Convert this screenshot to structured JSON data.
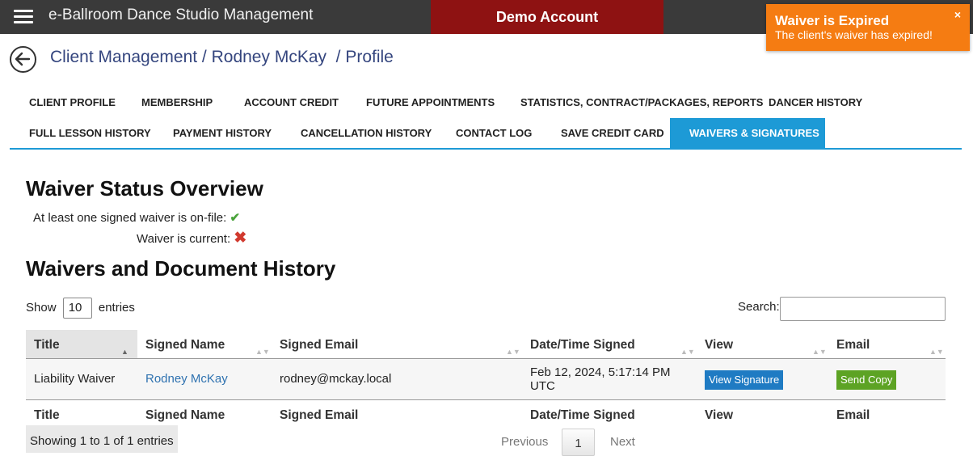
{
  "header": {
    "app_title": "e-Ballroom Dance Studio Management",
    "demo_banner": "Demo Account"
  },
  "toast": {
    "title": "Waiver is Expired",
    "message": "The client's waiver has expired!",
    "close": "×",
    "color": "#f57c12"
  },
  "breadcrumb": {
    "text": "Client Management / Rodney McKay  / Profile"
  },
  "tabs": {
    "row1": [
      "CLIENT PROFILE",
      "MEMBERSHIP",
      "ACCOUNT CREDIT",
      "FUTURE APPOINTMENTS",
      "STATISTICS, CONTRACT/PACKAGES, REPORTS",
      "DANCER HISTORY"
    ],
    "row2": [
      "FULL LESSON HISTORY",
      "PAYMENT HISTORY",
      "CANCELLATION HISTORY",
      "CONTACT LOG",
      "SAVE CREDIT CARD",
      "WAIVERS & SIGNATURES"
    ],
    "active": "WAIVERS & SIGNATURES"
  },
  "overview": {
    "heading": "Waiver Status Overview",
    "on_file_label": "At least one signed waiver is on-file:",
    "on_file_icon": "✔",
    "current_label": "Waiver is current:",
    "current_icon": "✖"
  },
  "history": {
    "heading": "Waivers and Document History",
    "show_label": "Show",
    "entries_value": "10",
    "entries_label": "entries",
    "search_label": "Search:",
    "search_value": "",
    "columns": [
      "Title",
      "Signed Name",
      "Signed Email",
      "Date/Time Signed",
      "View",
      "Email"
    ],
    "rows": [
      {
        "title": "Liability Waiver",
        "signed_name": "Rodney McKay",
        "signed_email": "rodney@mckay.local",
        "date_line1": "Feb 12, 2024, 5:17:14 PM",
        "date_line2": "UTC",
        "view_button": "View Signature",
        "email_button": "Send Copy"
      }
    ],
    "info": "Showing 1 to 1 of 1 entries",
    "pager": {
      "previous": "Previous",
      "page": "1",
      "next": "Next"
    }
  },
  "colors": {
    "topbar": "#3a3a3a",
    "demo_banner": "#8e1212",
    "active_tab": "#1d9ad6",
    "view_button": "#1f7bc3",
    "send_button": "#5da324",
    "check": "#4aa33b",
    "cross": "#d13a2f"
  }
}
